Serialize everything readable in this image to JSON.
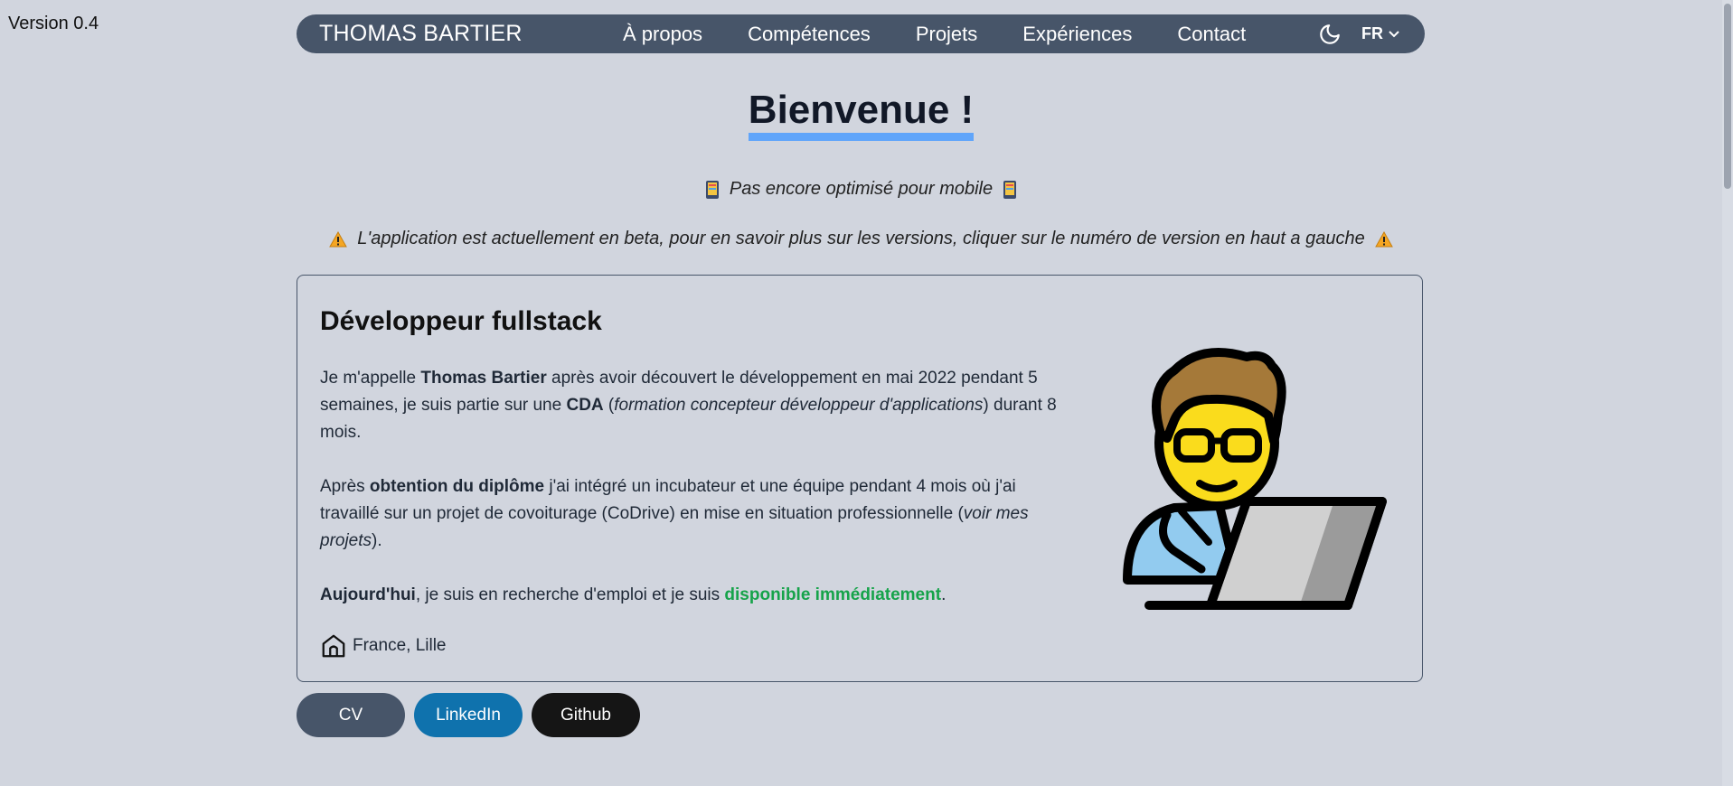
{
  "version_label": "Version 0.4",
  "navbar": {
    "brand": "THOMAS BARTIER",
    "links": [
      "À propos",
      "Compétences",
      "Projets",
      "Expériences",
      "Contact"
    ],
    "language": "FR",
    "theme_icon": "moon-icon"
  },
  "hero": {
    "title": "Bienvenue !",
    "mobile_notice": "Pas encore optimisé pour mobile",
    "beta_notice": "L'application est actuellement en beta, pour en savoir plus sur les versions, cliquer sur le numéro de version en haut a gauche"
  },
  "card": {
    "title": "Développeur fullstack",
    "p1": {
      "a": "Je m'appelle ",
      "name": "Thomas Bartier",
      "b": " après avoir découvert le développement en mai 2022 pendant 5 semaines, je suis partie sur une ",
      "cda": "CDA",
      "c": " (",
      "cda_full": "formation concepteur développeur d'applications",
      "d": ") durant 8 mois."
    },
    "p2": {
      "a": "Après ",
      "diploma": "obtention du diplôme",
      "b": " j'ai intégré un incubateur et une équipe pendant 4 mois où j'ai travaillé sur un projet de covoiturage (CoDrive) en mise en situation professionnelle (",
      "projects": "voir mes projets",
      "c": ")."
    },
    "p3": {
      "today": "Aujourd'hui",
      "a": ", je suis en recherche d'emploi et je suis ",
      "available": "disponible immédiatement",
      "b": "."
    },
    "location": "France, Lille"
  },
  "buttons": {
    "cv": "CV",
    "linkedin": "LinkedIn",
    "github": "Github"
  },
  "colors": {
    "background": "#d1d5de",
    "navbar": "#475569",
    "accent_underline": "#60a5fa",
    "available": "#16a34a",
    "linkedin": "#0f72ad",
    "github": "#151515"
  }
}
